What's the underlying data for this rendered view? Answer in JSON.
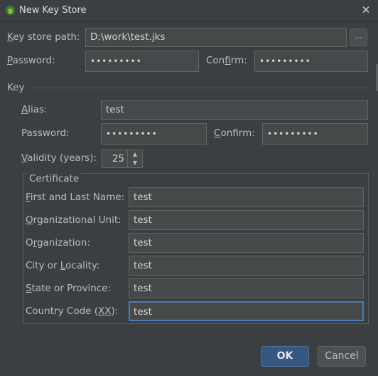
{
  "window": {
    "title": "New Key Store",
    "close_symbol": "✕"
  },
  "keystore": {
    "path_label": "Key store path:",
    "path_value": "D:\\work\\test.jks",
    "browse_label": "...",
    "password_label": "Password:",
    "password_value": "•••••••••",
    "confirm_label": "Confirm:",
    "confirm_value": "•••••••••"
  },
  "key": {
    "section_label": "Key",
    "alias_label": "Alias:",
    "alias_value": "test",
    "password_label": "Password:",
    "password_value": "•••••••••",
    "confirm_label": "Confirm:",
    "confirm_value": "•••••••••",
    "validity_label": "Validity (years):",
    "validity_value": "25"
  },
  "certificate": {
    "section_label": "Certificate",
    "fields": [
      {
        "label": "First and Last Name:",
        "value": "test"
      },
      {
        "label": "Organizational Unit:",
        "value": "test"
      },
      {
        "label": "Organization:",
        "value": "test"
      },
      {
        "label": "City or Locality:",
        "value": "test"
      },
      {
        "label": "State or Province:",
        "value": "test"
      },
      {
        "label": "Country Code (XX):",
        "value": "test"
      }
    ]
  },
  "buttons": {
    "ok": "OK",
    "cancel": "Cancel"
  },
  "colors": {
    "accent": "#365880",
    "focus_border": "#4a7db5",
    "background": "#3c3f41",
    "field_bg": "#45494a",
    "android_green": "#a4c639"
  }
}
